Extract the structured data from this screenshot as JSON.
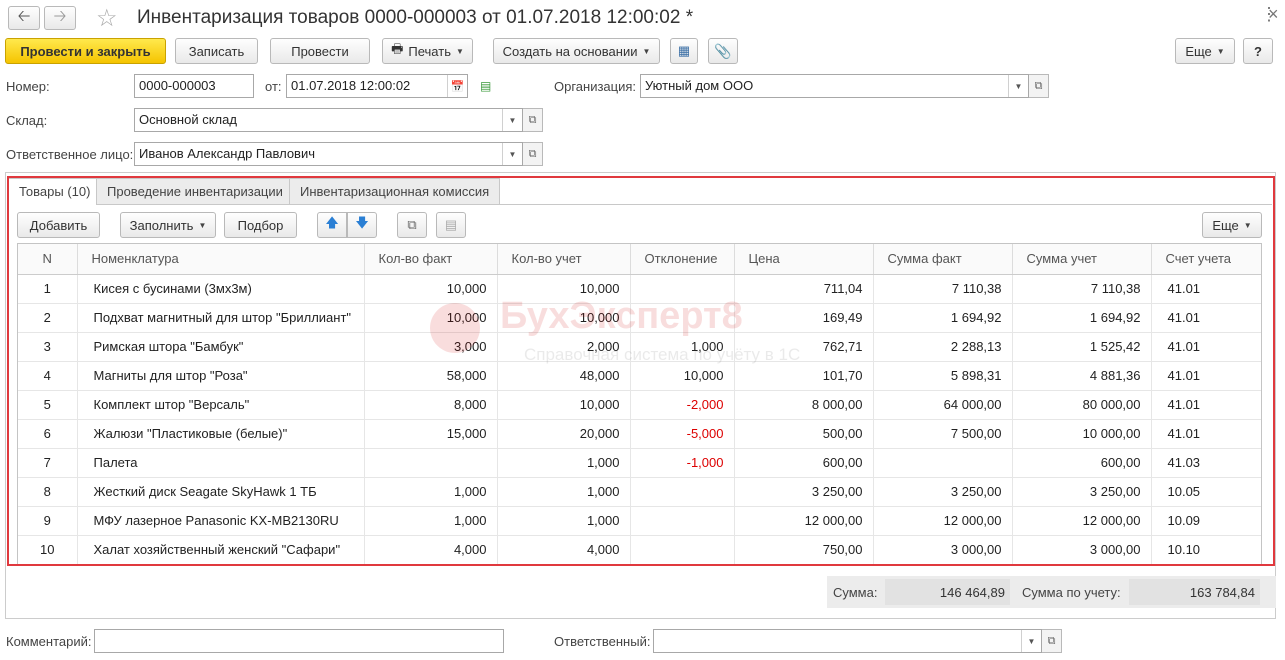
{
  "window": {
    "title": "Инвентаризация товаров 0000-000003 от 01.07.2018 12:00:02 *"
  },
  "toolbar": {
    "post_close": "Провести и закрыть",
    "save": "Записать",
    "post": "Провести",
    "print": "Печать",
    "create_based": "Создать на основании",
    "more": "Еще",
    "help": "?"
  },
  "form": {
    "number_label": "Номер:",
    "number_value": "0000-000003",
    "date_label": "от:",
    "date_value": "01.07.2018 12:00:02",
    "org_label": "Организация:",
    "org_value": "Уютный дом ООО",
    "warehouse_label": "Склад:",
    "warehouse_value": "Основной склад",
    "responsible_label": "Ответственное лицо:",
    "responsible_value": "Иванов Александр Павлович"
  },
  "tabs": [
    {
      "label": "Товары (10)"
    },
    {
      "label": "Проведение инвентаризации"
    },
    {
      "label": "Инвентаризационная комиссия"
    }
  ],
  "table_toolbar": {
    "add": "Добавить",
    "fill": "Заполнить",
    "pick": "Подбор",
    "more": "Еще"
  },
  "table": {
    "columns": [
      "N",
      "Номенклатура",
      "Кол-во факт",
      "Кол-во учет",
      "Отклонение",
      "Цена",
      "Сумма факт",
      "Сумма учет",
      "Счет учета"
    ],
    "rows": [
      {
        "n": "1",
        "name": "Кисея с бусинами (3мх3м)",
        "qty_fact": "10,000",
        "qty_acc": "10,000",
        "dev": "",
        "price": "711,04",
        "sum_fact": "7 110,38",
        "sum_acc": "7 110,38",
        "account": "41.01"
      },
      {
        "n": "2",
        "name": "Подхват магнитный для штор \"Бриллиант\"",
        "qty_fact": "10,000",
        "qty_acc": "10,000",
        "dev": "",
        "price": "169,49",
        "sum_fact": "1 694,92",
        "sum_acc": "1 694,92",
        "account": "41.01"
      },
      {
        "n": "3",
        "name": "Римская штора \"Бамбук\"",
        "qty_fact": "3,000",
        "qty_acc": "2,000",
        "dev": "1,000",
        "price": "762,71",
        "sum_fact": "2 288,13",
        "sum_acc": "1 525,42",
        "account": "41.01"
      },
      {
        "n": "4",
        "name": "Магниты для штор \"Роза\"",
        "qty_fact": "58,000",
        "qty_acc": "48,000",
        "dev": "10,000",
        "price": "101,70",
        "sum_fact": "5 898,31",
        "sum_acc": "4 881,36",
        "account": "41.01"
      },
      {
        "n": "5",
        "name": "Комплект штор \"Версаль\"",
        "qty_fact": "8,000",
        "qty_acc": "10,000",
        "dev": "-2,000",
        "price": "8 000,00",
        "sum_fact": "64 000,00",
        "sum_acc": "80 000,00",
        "account": "41.01"
      },
      {
        "n": "6",
        "name": "Жалюзи \"Пластиковые (белые)\"",
        "qty_fact": "15,000",
        "qty_acc": "20,000",
        "dev": "-5,000",
        "price": "500,00",
        "sum_fact": "7 500,00",
        "sum_acc": "10 000,00",
        "account": "41.01"
      },
      {
        "n": "7",
        "name": "Палета",
        "qty_fact": "",
        "qty_acc": "1,000",
        "dev": "-1,000",
        "price": "600,00",
        "sum_fact": "",
        "sum_acc": "600,00",
        "account": "41.03"
      },
      {
        "n": "8",
        "name": "Жесткий диск Seagate SkyHawk 1 ТБ",
        "qty_fact": "1,000",
        "qty_acc": "1,000",
        "dev": "",
        "price": "3 250,00",
        "sum_fact": "3 250,00",
        "sum_acc": "3 250,00",
        "account": "10.05"
      },
      {
        "n": "9",
        "name": "МФУ лазерное Panasonic KX-MB2130RU",
        "qty_fact": "1,000",
        "qty_acc": "1,000",
        "dev": "",
        "price": "12 000,00",
        "sum_fact": "12 000,00",
        "sum_acc": "12 000,00",
        "account": "10.09"
      },
      {
        "n": "10",
        "name": "Халат хозяйственный женский \"Сафари\"",
        "qty_fact": "4,000",
        "qty_acc": "4,000",
        "dev": "",
        "price": "750,00",
        "sum_fact": "3 000,00",
        "sum_acc": "3 000,00",
        "account": "10.10"
      }
    ]
  },
  "totals": {
    "sum_label": "Сумма:",
    "sum_value": "146 464,89",
    "sum_acc_label": "Сумма по учету:",
    "sum_acc_value": "163 784,84"
  },
  "footer": {
    "comment_label": "Комментарий:",
    "comment_value": "",
    "responsible_label": "Ответственный:",
    "responsible_value": ""
  },
  "watermark": {
    "title": "БухЭксперт8",
    "subtitle": "Справочная система по учёту в 1С"
  },
  "colors": {
    "primary_button": "#f5c400",
    "highlight_frame": "#e0393e",
    "negative_value": "#dd0000"
  },
  "icons": [
    "back-arrow-icon",
    "forward-arrow-icon",
    "star-icon",
    "printer-icon",
    "structure-icon",
    "paperclip-icon",
    "calendar-icon",
    "post-status-icon",
    "arrow-up-icon",
    "arrow-down-icon",
    "copy-icon",
    "paste-icon",
    "open-form-icon",
    "chevron-down-icon"
  ]
}
